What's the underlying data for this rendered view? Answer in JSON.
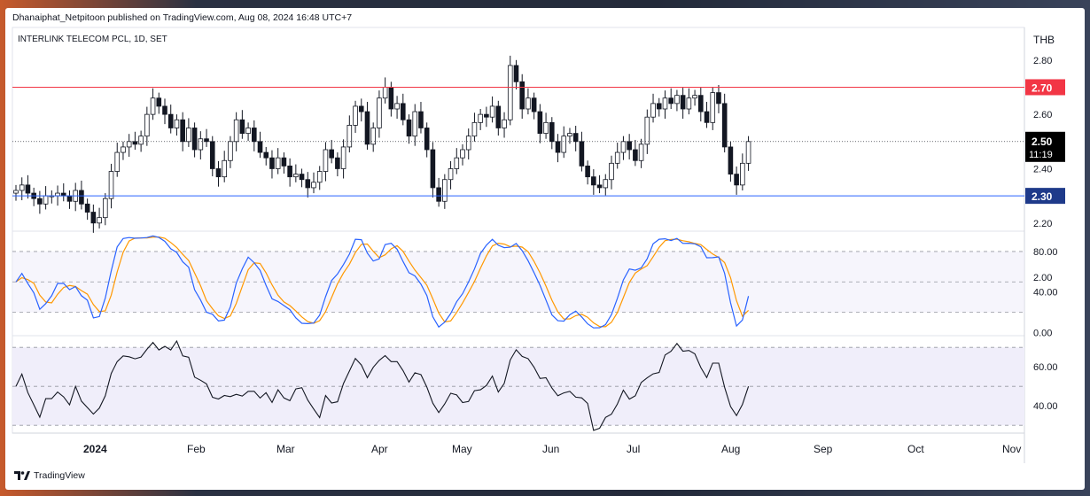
{
  "header": {
    "published": "Dhanaiphat_Netpitoon published on TradingView.com, Aug 08, 2024 16:48 UTC+7",
    "symbol": "INTERLINK TELECOM PCL, 1D, SET",
    "currency": "THB",
    "watermark": "TradingView"
  },
  "colors": {
    "resistance": "#f23645",
    "support": "#2962ff",
    "up_candle": "#ffffff",
    "down_candle": "#131722",
    "stoch_k": "#2962ff",
    "stoch_d": "#ff9800",
    "rsi": "#131722",
    "band": "#f0eefa"
  },
  "chart_data": [
    {
      "type": "candlestick",
      "ylim": [
        2.17,
        2.92
      ],
      "y_ticks": [
        "2.80",
        "2.60",
        "2.40",
        "2.20",
        "2.00"
      ],
      "levels": [
        {
          "value": 2.7,
          "label": "2.70"
        },
        {
          "value": 2.3,
          "label": "2.30"
        }
      ],
      "last_price": {
        "value": 2.5,
        "label": "2.50",
        "countdown": "11:19"
      },
      "x_ticks": [
        "2024",
        "Feb",
        "Mar",
        "Apr",
        "May",
        "Jun",
        "Jul",
        "Aug",
        "Sep",
        "Oct",
        "Nov"
      ],
      "closes": [
        2.32,
        2.34,
        2.31,
        2.29,
        2.27,
        2.3,
        2.3,
        2.31,
        2.3,
        2.28,
        2.32,
        2.27,
        2.24,
        2.2,
        2.22,
        2.29,
        2.39,
        2.46,
        2.48,
        2.5,
        2.49,
        2.52,
        2.6,
        2.66,
        2.63,
        2.6,
        2.55,
        2.58,
        2.5,
        2.55,
        2.47,
        2.51,
        2.5,
        2.4,
        2.37,
        2.43,
        2.5,
        2.58,
        2.53,
        2.55,
        2.5,
        2.46,
        2.44,
        2.4,
        2.44,
        2.41,
        2.37,
        2.38,
        2.36,
        2.33,
        2.35,
        2.39,
        2.47,
        2.44,
        2.4,
        2.48,
        2.56,
        2.63,
        2.61,
        2.49,
        2.55,
        2.66,
        2.7,
        2.62,
        2.64,
        2.58,
        2.52,
        2.61,
        2.55,
        2.47,
        2.33,
        2.28,
        2.36,
        2.4,
        2.44,
        2.47,
        2.52,
        2.57,
        2.6,
        2.59,
        2.63,
        2.55,
        2.58,
        2.78,
        2.72,
        2.62,
        2.66,
        2.61,
        2.53,
        2.57,
        2.5,
        2.46,
        2.52,
        2.53,
        2.5,
        2.41,
        2.37,
        2.34,
        2.33,
        2.36,
        2.42,
        2.46,
        2.5,
        2.47,
        2.43,
        2.49,
        2.59,
        2.64,
        2.62,
        2.66,
        2.64,
        2.67,
        2.62,
        2.66,
        2.67,
        2.61,
        2.57,
        2.68,
        2.64,
        2.48,
        2.38,
        2.34,
        2.42,
        2.5
      ],
      "stochastic": {
        "ylim": [
          -3,
          100
        ],
        "y_ticks": [
          "80.00",
          "40.00",
          "0.00"
        ],
        "bands": [
          80,
          50,
          20
        ],
        "k_last": 36,
        "d_last": 22
      },
      "rsi": {
        "ylim": [
          26,
          76
        ],
        "y_ticks": [
          "60.00",
          "40.00"
        ],
        "bands": [
          70,
          50,
          30
        ],
        "last": 50
      }
    }
  ]
}
